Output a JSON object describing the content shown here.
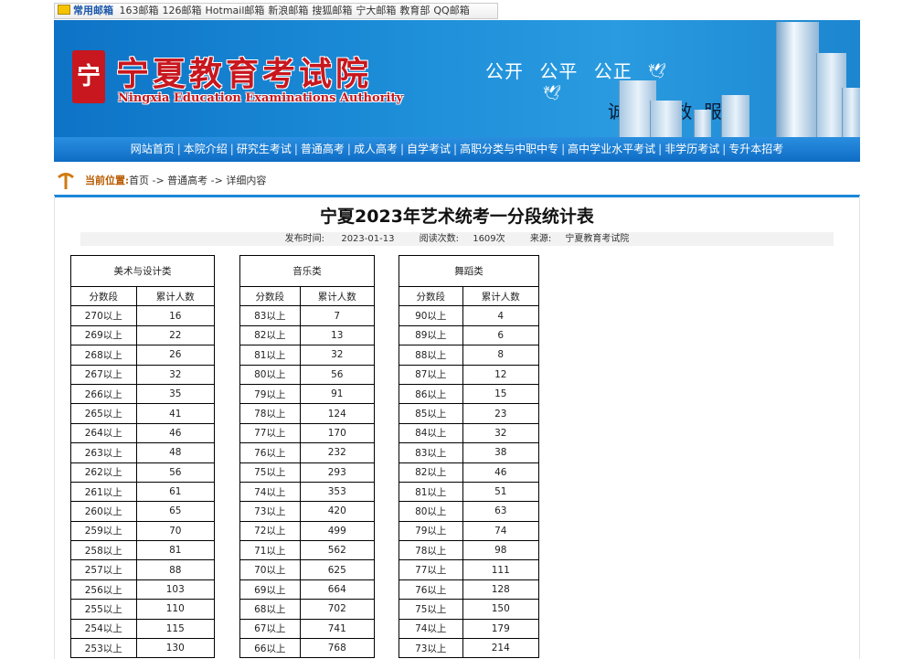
{
  "mail_bar": {
    "title": "常用邮箱",
    "links": [
      "163邮箱",
      "126邮箱",
      "Hotmail邮箱",
      "新浪邮箱",
      "搜狐邮箱",
      "宁大邮箱",
      "教育部",
      "QQ邮箱"
    ]
  },
  "banner": {
    "logo_seal": "宁",
    "logo_cn": "宁夏教育考试院",
    "logo_en": "Ningxia Education Examinations Authority",
    "slogan1": "公开  公平  公正",
    "slogan2": "诚实  高效  服务"
  },
  "nav": {
    "items": [
      "网站首页",
      "本院介绍",
      "研究生考试",
      "普通高考",
      "成人高考",
      "自学考试",
      "高职分类与中职中专",
      "高中学业水平考试",
      "非学历考试",
      "专升本招考"
    ],
    "separator": "|"
  },
  "breadcrumb": {
    "label": "当前位置:",
    "path": "首页 -> 普通高考 -> 详细内容"
  },
  "article": {
    "title": "宁夏2023年艺术统考一分段统计表",
    "meta": {
      "date_label": "发布时间:",
      "date": "2023-01-13",
      "views_label": "阅读次数:",
      "views": "1609次",
      "source_label": "来源:",
      "source": "宁夏教育考试院"
    }
  },
  "tables": [
    {
      "category": "美术与设计类",
      "col_score": "分数段",
      "col_count": "累计人数",
      "rows": [
        [
          "270以上",
          "16"
        ],
        [
          "269以上",
          "22"
        ],
        [
          "268以上",
          "26"
        ],
        [
          "267以上",
          "32"
        ],
        [
          "266以上",
          "35"
        ],
        [
          "265以上",
          "41"
        ],
        [
          "264以上",
          "46"
        ],
        [
          "263以上",
          "48"
        ],
        [
          "262以上",
          "56"
        ],
        [
          "261以上",
          "61"
        ],
        [
          "260以上",
          "65"
        ],
        [
          "259以上",
          "70"
        ],
        [
          "258以上",
          "81"
        ],
        [
          "257以上",
          "88"
        ],
        [
          "256以上",
          "103"
        ],
        [
          "255以上",
          "110"
        ],
        [
          "254以上",
          "115"
        ],
        [
          "253以上",
          "130"
        ]
      ]
    },
    {
      "category": "音乐类",
      "col_score": "分数段",
      "col_count": "累计人数",
      "rows": [
        [
          "83以上",
          "7"
        ],
        [
          "82以上",
          "13"
        ],
        [
          "81以上",
          "32"
        ],
        [
          "80以上",
          "56"
        ],
        [
          "79以上",
          "91"
        ],
        [
          "78以上",
          "124"
        ],
        [
          "77以上",
          "170"
        ],
        [
          "76以上",
          "232"
        ],
        [
          "75以上",
          "293"
        ],
        [
          "74以上",
          "353"
        ],
        [
          "73以上",
          "420"
        ],
        [
          "72以上",
          "499"
        ],
        [
          "71以上",
          "562"
        ],
        [
          "70以上",
          "625"
        ],
        [
          "69以上",
          "664"
        ],
        [
          "68以上",
          "702"
        ],
        [
          "67以上",
          "741"
        ],
        [
          "66以上",
          "768"
        ]
      ]
    },
    {
      "category": "舞蹈类",
      "col_score": "分数段",
      "col_count": "累计人数",
      "rows": [
        [
          "90以上",
          "4"
        ],
        [
          "89以上",
          "6"
        ],
        [
          "88以上",
          "8"
        ],
        [
          "87以上",
          "12"
        ],
        [
          "86以上",
          "15"
        ],
        [
          "85以上",
          "23"
        ],
        [
          "84以上",
          "32"
        ],
        [
          "83以上",
          "38"
        ],
        [
          "82以上",
          "46"
        ],
        [
          "81以上",
          "51"
        ],
        [
          "80以上",
          "63"
        ],
        [
          "79以上",
          "74"
        ],
        [
          "78以上",
          "98"
        ],
        [
          "77以上",
          "111"
        ],
        [
          "76以上",
          "128"
        ],
        [
          "75以上",
          "150"
        ],
        [
          "74以上",
          "179"
        ],
        [
          "73以上",
          "214"
        ]
      ]
    }
  ]
}
